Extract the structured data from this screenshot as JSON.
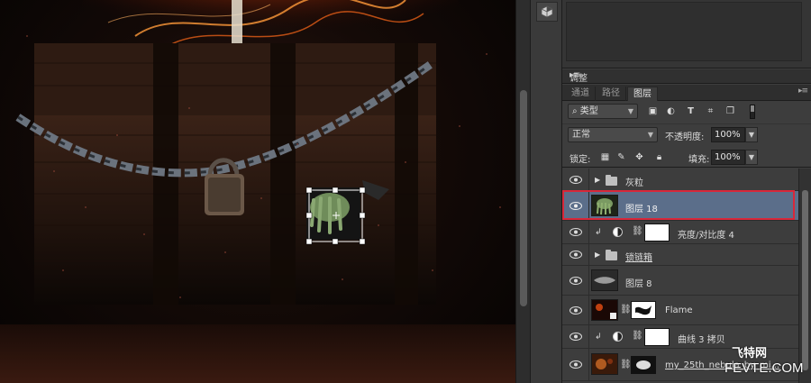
{
  "panels": {
    "adjustments_tab": "调整",
    "tabs": [
      {
        "label": "通道",
        "active": false
      },
      {
        "label": "路径",
        "active": false
      },
      {
        "label": "图层",
        "active": true
      }
    ]
  },
  "layers_panel": {
    "filter_kind": "类型",
    "blend_mode": "正常",
    "opacity_label": "不透明度:",
    "opacity_value": "100%",
    "lock_label": "锁定:",
    "fill_label": "填充:",
    "fill_value": "100%"
  },
  "layers": [
    {
      "name": "灰粒",
      "kind": "group"
    },
    {
      "name": "图层 18",
      "kind": "pixel",
      "selected": true
    },
    {
      "name": "亮度/对比度 4",
      "kind": "adjustment",
      "clipped": true
    },
    {
      "name": "锁链箱",
      "kind": "group"
    },
    {
      "name": "图层 8",
      "kind": "pixel"
    },
    {
      "name": "Flame",
      "kind": "pixel-masked"
    },
    {
      "name": "曲线 3 拷贝",
      "kind": "adjustment",
      "clipped": true
    },
    {
      "name": "my_25th_nebula_by_mi...",
      "kind": "pixel-masked"
    }
  ],
  "watermark": {
    "line1": "飞特网",
    "line2": "FEVTE.COM"
  },
  "colors": {
    "selection_highlight": "#5b6e8a",
    "selection_outline": "#d8283a",
    "panel_bg": "#3d3d3d"
  }
}
